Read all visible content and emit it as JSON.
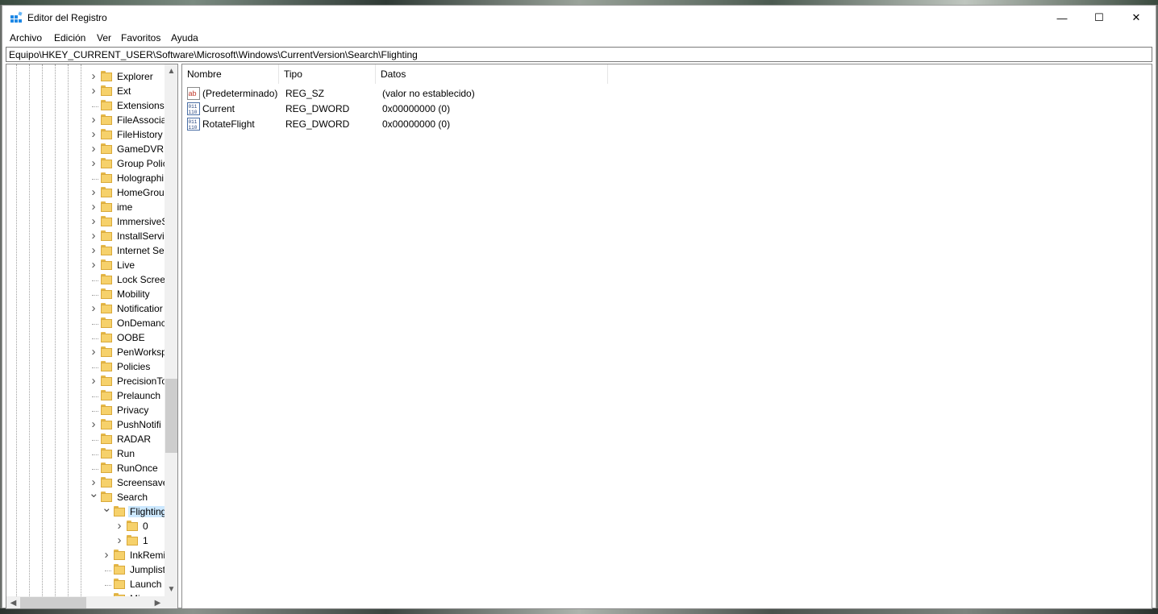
{
  "window": {
    "title": "Editor del Registro",
    "controls": {
      "minimize": "—",
      "maximize": "☐",
      "close": "✕"
    }
  },
  "menu": [
    "Archivo",
    "Edición",
    "Ver",
    "Favoritos",
    "Ayuda"
  ],
  "address": "Equipo\\HKEY_CURRENT_USER\\Software\\Microsoft\\Windows\\CurrentVersion\\Search\\Flighting",
  "tree": [
    {
      "label": "Explorer",
      "level": 0,
      "expander": "collapsed"
    },
    {
      "label": "Ext",
      "level": 0,
      "expander": "collapsed"
    },
    {
      "label": "Extensions",
      "level": 0,
      "expander": "none"
    },
    {
      "label": "FileAssocia",
      "level": 0,
      "expander": "collapsed"
    },
    {
      "label": "FileHistory",
      "level": 0,
      "expander": "collapsed"
    },
    {
      "label": "GameDVR",
      "level": 0,
      "expander": "collapsed"
    },
    {
      "label": "Group Polic",
      "level": 0,
      "expander": "collapsed"
    },
    {
      "label": "Holographi",
      "level": 0,
      "expander": "none"
    },
    {
      "label": "HomeGrou",
      "level": 0,
      "expander": "collapsed"
    },
    {
      "label": "ime",
      "level": 0,
      "expander": "collapsed"
    },
    {
      "label": "ImmersiveS",
      "level": 0,
      "expander": "collapsed"
    },
    {
      "label": "InstallServi",
      "level": 0,
      "expander": "collapsed"
    },
    {
      "label": "Internet Set",
      "level": 0,
      "expander": "collapsed"
    },
    {
      "label": "Live",
      "level": 0,
      "expander": "collapsed"
    },
    {
      "label": "Lock Screer",
      "level": 0,
      "expander": "none"
    },
    {
      "label": "Mobility",
      "level": 0,
      "expander": "none"
    },
    {
      "label": "Notificatior",
      "level": 0,
      "expander": "collapsed"
    },
    {
      "label": "OnDemanc",
      "level": 0,
      "expander": "none"
    },
    {
      "label": "OOBE",
      "level": 0,
      "expander": "none"
    },
    {
      "label": "PenWorksp",
      "level": 0,
      "expander": "collapsed"
    },
    {
      "label": "Policies",
      "level": 0,
      "expander": "none"
    },
    {
      "label": "PrecisionTo",
      "level": 0,
      "expander": "collapsed"
    },
    {
      "label": "Prelaunch",
      "level": 0,
      "expander": "none"
    },
    {
      "label": "Privacy",
      "level": 0,
      "expander": "none"
    },
    {
      "label": "PushNotifi",
      "level": 0,
      "expander": "collapsed"
    },
    {
      "label": "RADAR",
      "level": 0,
      "expander": "none"
    },
    {
      "label": "Run",
      "level": 0,
      "expander": "none"
    },
    {
      "label": "RunOnce",
      "level": 0,
      "expander": "none"
    },
    {
      "label": "Screensave",
      "level": 0,
      "expander": "collapsed"
    },
    {
      "label": "Search",
      "level": 0,
      "expander": "expanded"
    },
    {
      "label": "Flighting",
      "level": 1,
      "expander": "expanded",
      "selected": true
    },
    {
      "label": "0",
      "level": 2,
      "expander": "collapsed"
    },
    {
      "label": "1",
      "level": 2,
      "expander": "collapsed"
    },
    {
      "label": "InkRemi",
      "level": 1,
      "expander": "collapsed"
    },
    {
      "label": "Jumplist",
      "level": 1,
      "expander": "none"
    },
    {
      "label": "Launch",
      "level": 1,
      "expander": "none"
    },
    {
      "label": "Microso",
      "level": 1,
      "expander": "collapsed"
    }
  ],
  "values_table": {
    "headers": [
      "Nombre",
      "Tipo",
      "Datos"
    ],
    "rows": [
      {
        "name": "(Predeterminado)",
        "type": "REG_SZ",
        "data": "(valor no establecido)",
        "icon": "string-value-icon"
      },
      {
        "name": "Current",
        "type": "REG_DWORD",
        "data": "0x00000000 (0)",
        "icon": "binary-value-icon"
      },
      {
        "name": "RotateFlight",
        "type": "REG_DWORD",
        "data": "0x00000000 (0)",
        "icon": "binary-value-icon"
      }
    ]
  },
  "colors": {
    "selection": "#cce8ff",
    "folder": "#f6d16b",
    "accent": "#0078d7"
  }
}
